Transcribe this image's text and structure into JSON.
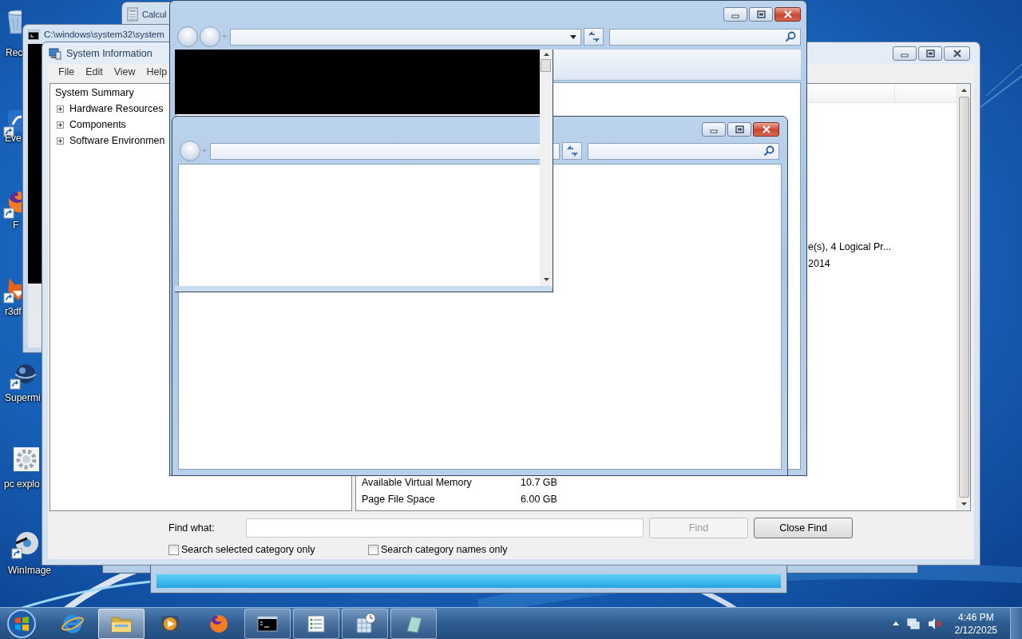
{
  "desktop": {
    "icons": [
      {
        "kind": "recycle-bin",
        "label": "Rec"
      },
      {
        "kind": "shortcut-app",
        "label": "Eve"
      },
      {
        "kind": "firefox",
        "label": "F"
      },
      {
        "kind": "fox",
        "label": "r3df"
      },
      {
        "kind": "globe",
        "label": "Supermi"
      },
      {
        "kind": "gear",
        "label": "pc explo"
      },
      {
        "kind": "disc",
        "label": "WinImage"
      }
    ]
  },
  "calculator_window": {
    "title": "Calcul"
  },
  "console_window": {
    "title": "C:\\windows\\system32\\system"
  },
  "system_information": {
    "title": "System Information",
    "menu": [
      "File",
      "Edit",
      "View",
      "Help"
    ],
    "tree": [
      {
        "label": "System Summary",
        "children": [
          {
            "label": "Hardware Resources",
            "expanded": false
          },
          {
            "label": "Components",
            "expanded": false
          },
          {
            "label": "Software Environmen",
            "expanded": false
          }
        ]
      }
    ],
    "details": {
      "cut_rows": [
        {
          "value": "e(s), 4 Logical Pr..."
        },
        {
          "value": "2014"
        }
      ],
      "rows": [
        {
          "item": "Available Virtual Memory",
          "value": "10.7 GB"
        },
        {
          "item": "Page File Space",
          "value": "6.00 GB"
        }
      ]
    },
    "find": {
      "label": "Find what:",
      "buttons": [
        {
          "label": "Find",
          "disabled": true
        },
        {
          "label": "Close Find",
          "disabled": false
        }
      ],
      "options": [
        {
          "label": "Search selected category only",
          "checked": false
        },
        {
          "label": "Search category names only",
          "checked": false
        }
      ]
    }
  },
  "taskbar": {
    "buttons": [
      {
        "kind": "internet-explorer",
        "running": false,
        "active": false
      },
      {
        "kind": "folder",
        "running": true,
        "active": true
      },
      {
        "kind": "media",
        "running": false,
        "active": false
      },
      {
        "kind": "firefox",
        "running": false,
        "active": false
      },
      {
        "kind": "console",
        "running": true,
        "active": false
      },
      {
        "kind": "list",
        "running": true,
        "active": false
      },
      {
        "kind": "calculator",
        "running": true,
        "active": false
      },
      {
        "kind": "document",
        "running": true,
        "active": false
      }
    ],
    "clock": {
      "time": "4:46 PM",
      "date": "2/12/2025"
    }
  }
}
